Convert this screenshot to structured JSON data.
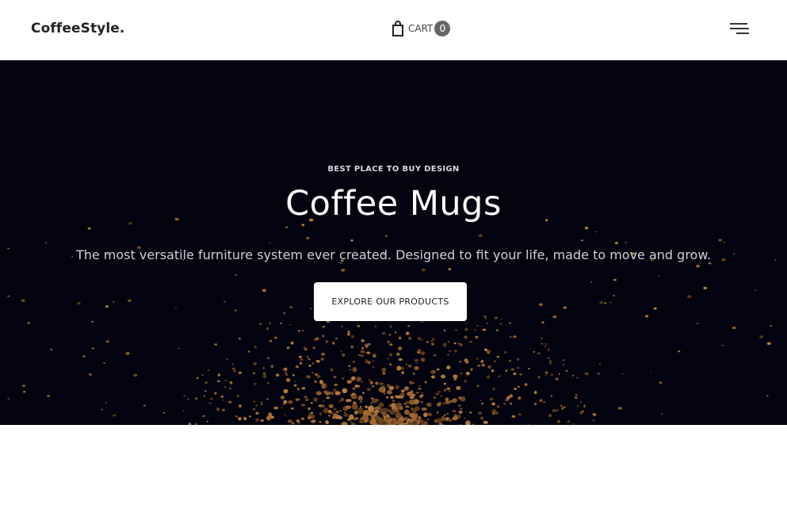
{
  "header": {
    "logo": "CoffeeStyle.",
    "cart": {
      "label": "CART",
      "count": "0",
      "icon": "shopping-bag-icon"
    },
    "menu": {
      "icon": "hamburger-menu-icon"
    }
  },
  "hero": {
    "eyebrow": "BEST PLACE TO BUY DESIGN",
    "title": "Coffee Mugs",
    "subtitle": "The most versatile furniture system ever created. Designed to fit your life, made to move and grow.",
    "cta_label": "EXPLORE OUR PRODUCTS",
    "background_image": "coffee-grounds-splash"
  },
  "colors": {
    "hero_background": "#03030f",
    "text_dark": "#222222",
    "badge": "#666666",
    "grounds": "#8a5a2b"
  }
}
